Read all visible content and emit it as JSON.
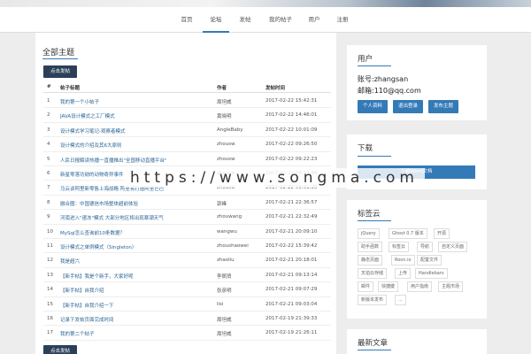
{
  "nav": {
    "items": [
      {
        "label": "首页",
        "active": false
      },
      {
        "label": "论坛",
        "active": true
      },
      {
        "label": "发帖",
        "active": false
      },
      {
        "label": "我的帖子",
        "active": false
      },
      {
        "label": "用户",
        "active": false
      },
      {
        "label": "注册",
        "active": false
      }
    ]
  },
  "main": {
    "title": "全部主题",
    "post_button": "点击发帖",
    "headers": {
      "num": "#",
      "title": "帖子标题",
      "author": "作者",
      "time": "发帖时间"
    },
    "rows": [
      {
        "num": "1",
        "title": "我的第一个小帖子",
        "author": "周坦威",
        "time": "2017-02-22 15:42:31"
      },
      {
        "num": "2",
        "title": "JAVA设计模式之工厂模式",
        "author": "黄晓明",
        "time": "2017-02-22 14:46:01"
      },
      {
        "num": "3",
        "title": "设计模式学习笔记-观察者模式",
        "author": "AngleBaby",
        "time": "2017-02-22 10:01:09"
      },
      {
        "num": "4",
        "title": "设计模式的介绍及其6大原则",
        "author": "zhousw",
        "time": "2017-02-22 09:26:50"
      },
      {
        "num": "5",
        "title": "人民日报解读热播一直播推出\"全国移动直播平台\"",
        "author": "zhousw",
        "time": "2017-02-22 09:22:23"
      },
      {
        "num": "6",
        "title": "新星零落功勋的动物奇异事件",
        "author": "zhousw",
        "time": "2017-02-22 09:12:48"
      },
      {
        "num": "7",
        "title": "马云谈阿里新零售上海战略 阿里将打造阿里巴巴",
        "author": "zhousw",
        "time": "2017-02-22 09:01:30"
      },
      {
        "num": "8",
        "title": "融合圈：中国德信市场整体超前体验",
        "author": "郭峰",
        "time": "2017-02-21 22:36:57"
      },
      {
        "num": "9",
        "title": "河南进入\"速冻\"模式 大部分地区将出现寒潮天气",
        "author": "zhouwang",
        "time": "2017-02-21 22:32:49"
      },
      {
        "num": "10",
        "title": "MySql怎么查询前10条数据？",
        "author": "wangwu",
        "time": "2017-02-21 20:09:10"
      },
      {
        "num": "11",
        "title": "设计模式之单例模式（Singleton）",
        "author": "zhoushaowei",
        "time": "2017-02-22 15:39:42"
      },
      {
        "num": "12",
        "title": "我是超六",
        "author": "zhaoliu",
        "time": "2017-02-21 20:18:01"
      },
      {
        "num": "13",
        "title": "【新手帖】我是个新手，大家好呢",
        "author": "李佩贤",
        "time": "2017-02-21 09:13:14"
      },
      {
        "num": "14",
        "title": "【新手帖】自我介绍",
        "author": "张彦明",
        "time": "2017-02-21 09:07:29"
      },
      {
        "num": "15",
        "title": "【新手帖】自我介绍一下",
        "author": "lisi",
        "time": "2017-02-21 09:03:04"
      },
      {
        "num": "16",
        "title": "记录下发帖页面完成时间",
        "author": "周坦威",
        "time": "2017-02-19 21:39:33"
      },
      {
        "num": "17",
        "title": "我的第二个帖子",
        "author": "周坦威",
        "time": "2017-02-19 21:26:11"
      }
    ]
  },
  "sidebar": {
    "user": {
      "title": "用户",
      "account": "账号:zhangsan",
      "email": "邮箱:110@qq.com",
      "buttons": [
        "个人资料",
        "退出登录",
        "发布主题"
      ]
    },
    "download": {
      "title": "下载",
      "button": "下载Word文档"
    },
    "tags": {
      "title": "标签云",
      "items": [
        "jQuery",
        "Ghost 0.7 版本",
        "开源",
        "助手函数",
        "标签云",
        "导航",
        "自定义页面",
        "静态页面",
        "Roon.io",
        "配置文件",
        "叉拍云存储",
        "上传",
        "Handlebars",
        "邮件",
        "快捷键",
        "用户指南",
        "主题市场",
        "新版本发布",
        "..."
      ]
    },
    "latest": {
      "title": "最新文章"
    }
  },
  "watermark": "https://www.songma.com",
  "colors": {
    "accent": "#337ab7",
    "dark_button": "#2b4058",
    "link": "#2a6496"
  }
}
